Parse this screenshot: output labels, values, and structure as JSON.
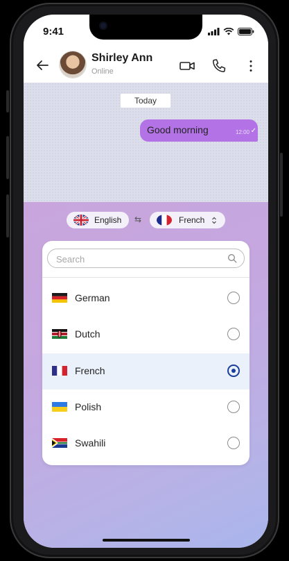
{
  "status": {
    "time": "9:41"
  },
  "header": {
    "contact_name": "Shirley Ann",
    "presence": "Online"
  },
  "chat": {
    "day_label": "Today",
    "messages": [
      {
        "text": "Good morning",
        "time": "12:00",
        "status": "read"
      }
    ]
  },
  "translate": {
    "source_language": "English",
    "target_language": "French",
    "search_placeholder": "Search",
    "languages": [
      {
        "label": "German",
        "flag": "germany-flag",
        "selected": false
      },
      {
        "label": "Dutch",
        "flag": "kenya-flag",
        "selected": false
      },
      {
        "label": "French",
        "flag": "france-flag",
        "selected": true
      },
      {
        "label": "Polish",
        "flag": "ukraine-flag",
        "selected": false
      },
      {
        "label": "Swahili",
        "flag": "south-africa-flag",
        "selected": false
      }
    ]
  },
  "colors": {
    "bubble": "#b373e6",
    "selected_row": "#eaf1fb",
    "radio_selected": "#1a3d9c",
    "panel_gradient_start": "#c8a6dd",
    "panel_gradient_end": "#a9b6ec"
  }
}
